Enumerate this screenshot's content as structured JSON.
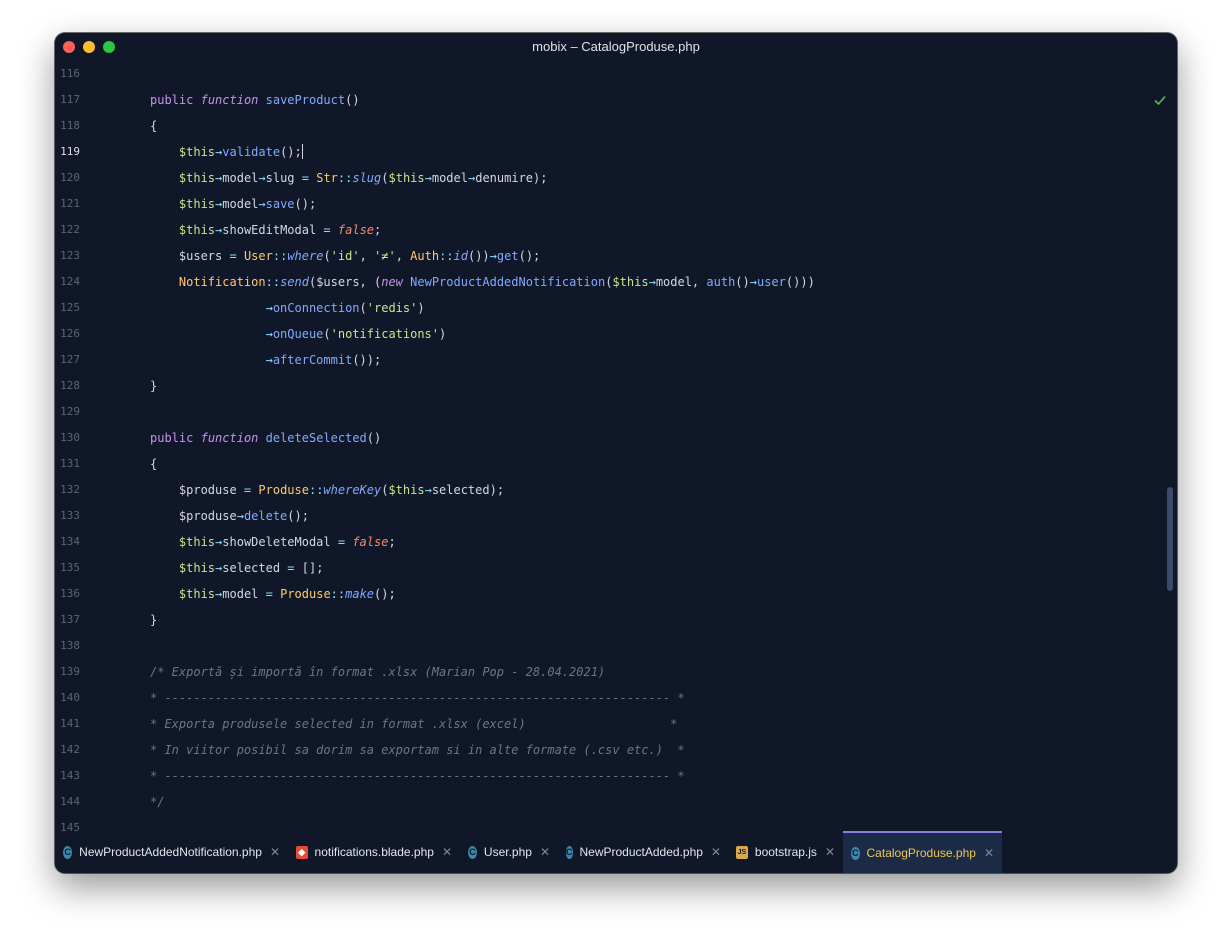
{
  "window": {
    "title": "mobix – CatalogProduse.php"
  },
  "editor": {
    "active_line": "119",
    "lines": [
      {
        "n": "116",
        "code": ""
      },
      {
        "n": "117",
        "code": "public function saveProduct()"
      },
      {
        "n": "118",
        "code": "{"
      },
      {
        "n": "119",
        "code": "    $this→validate();"
      },
      {
        "n": "120",
        "code": "    $this→model→slug = Str::slug($this→model→denumire);"
      },
      {
        "n": "121",
        "code": "    $this→model→save();"
      },
      {
        "n": "122",
        "code": "    $this→showEditModal = false;"
      },
      {
        "n": "123",
        "code": "    $users = User::where('id', '≠', Auth::id())→get();"
      },
      {
        "n": "124",
        "code": "    Notification::send($users, (new NewProductAddedNotification($this→model, auth()→user()))"
      },
      {
        "n": "125",
        "code": "                →onConnection('redis')"
      },
      {
        "n": "126",
        "code": "                →onQueue('notifications')"
      },
      {
        "n": "127",
        "code": "                →afterCommit());"
      },
      {
        "n": "128",
        "code": "}"
      },
      {
        "n": "129",
        "code": ""
      },
      {
        "n": "130",
        "code": "public function deleteSelected()"
      },
      {
        "n": "131",
        "code": "{"
      },
      {
        "n": "132",
        "code": "    $produse = Produse::whereKey($this→selected);"
      },
      {
        "n": "133",
        "code": "    $produse→delete();"
      },
      {
        "n": "134",
        "code": "    $this→showDeleteModal = false;"
      },
      {
        "n": "135",
        "code": "    $this→selected = [];"
      },
      {
        "n": "136",
        "code": "    $this→model = Produse::make();"
      },
      {
        "n": "137",
        "code": "}"
      },
      {
        "n": "138",
        "code": ""
      },
      {
        "n": "139",
        "code": "/* Exportă și importă în format .xlsx (Marian Pop - 28.04.2021)"
      },
      {
        "n": "140",
        "code": "* ---------------------------------------------------------------------- *"
      },
      {
        "n": "141",
        "code": "* Exporta produsele selected in format .xlsx (excel)                    *"
      },
      {
        "n": "142",
        "code": "* In viitor posibil sa dorim sa exportam si in alte formate (.csv etc.)  *"
      },
      {
        "n": "143",
        "code": "* ---------------------------------------------------------------------- *"
      },
      {
        "n": "144",
        "code": "*/"
      },
      {
        "n": "145",
        "code": ""
      }
    ]
  },
  "tabs": [
    {
      "label": "NewProductAddedNotification.php",
      "icon": "php-class-icon"
    },
    {
      "label": "notifications.blade.php",
      "icon": "blade-icon"
    },
    {
      "label": "User.php",
      "icon": "php-class-icon"
    },
    {
      "label": "NewProductAdded.php",
      "icon": "php-class-icon"
    },
    {
      "label": "bootstrap.js",
      "icon": "js-file-icon"
    },
    {
      "label": "CatalogProduse.php",
      "icon": "php-class-icon"
    }
  ],
  "active_tab": "CatalogProduse.php",
  "colors": {
    "background": "#0f1728",
    "keyword": "#c792ea",
    "function": "#82aaff",
    "variable": "#c3e88d",
    "class": "#ffcb6b",
    "boolean": "#f78c6c",
    "comment": "#6b7689",
    "active_tab_text": "#f0c457"
  }
}
